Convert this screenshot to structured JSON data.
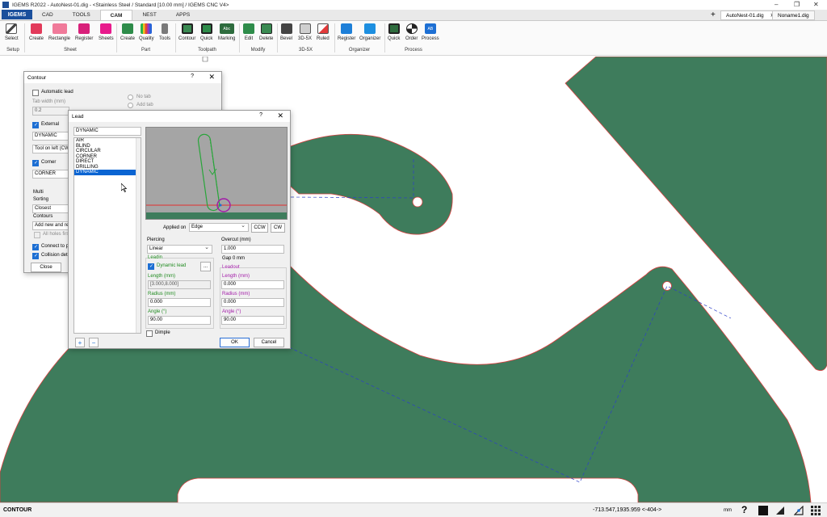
{
  "app": {
    "title": "IGEMS R2022 - AutoNest-01.dig - <Stainless Steel / Standard [10.00 mm] / IGEMS CNC V4>",
    "logo": "IGEMS",
    "tabs": [
      "CAD",
      "TOOLS",
      "CAM",
      "NEST",
      "APPS"
    ],
    "active_tab": "CAM",
    "doc_tabs": [
      "AutoNest-01.dig",
      "Noname1.dig"
    ]
  },
  "ribbon": {
    "buttons": {
      "select": "Select",
      "s_create": "Create",
      "rectangle": "Rectangle",
      "s_register": "Register",
      "sheets": "Sheets",
      "p_create": "Create",
      "quality": "Quality",
      "tools": "Tools",
      "contour": "Contour",
      "quick": "Quick",
      "marking": "Marking",
      "edit": "Edit",
      "delete": "Delete",
      "bevel": "Bevel",
      "threed5x": "3D-5X",
      "ruled": "Ruled",
      "o_register": "Register",
      "organizer": "Organizer",
      "pr_quick": "Quick",
      "order": "Order",
      "process": "Process"
    },
    "groups": {
      "setup": "Setup",
      "sheet": "Sheet",
      "part": "Part",
      "toolpath": "Toolpath",
      "modify": "Modify",
      "threed5x": "3D-5X",
      "organizer": "Organizer",
      "process": "Process"
    },
    "marking_icon_text": "Abc",
    "process_icon_text": "AB"
  },
  "contour_dialog": {
    "title": "Contour",
    "help": "?",
    "close_x": "✕",
    "automatic_lead": "Automatic lead",
    "tab_width_label": "Tab width (mm)",
    "tab_width_value": "0.2",
    "no_tab": "No tab",
    "add_tab": "Add tab",
    "external": "External",
    "external_value": "DYNAMIC",
    "tool_side": "Tool on left (CW)",
    "corner": "Corner",
    "corner_value": "CORNER",
    "multi": "Multi",
    "sorting": "Sorting",
    "sorting_value": "Closest",
    "contours": "Contours",
    "contours_value": "Add new and re",
    "all_holes": "All holes first",
    "connect": "Connect to pa",
    "collision": "Collision detec",
    "close_button": "Close"
  },
  "lead_dialog": {
    "title": "Lead",
    "help": "?",
    "close_x": "✕",
    "name_value": "DYNAMIC",
    "lead_types": [
      "AIR",
      "BLIND",
      "CIRCULAR",
      "CORNER",
      "DIRECT",
      "DRILLING",
      "DYNAMIC"
    ],
    "selected_type": "DYNAMIC",
    "applied_on_label": "Applied on",
    "applied_on_value": "Edge",
    "ccw": "CCW",
    "cw": "CW",
    "piercing_label": "Piercing",
    "piercing_value": "Linear",
    "overcut_label": "Overcut (mm)",
    "overcut_value": "1.000",
    "leadin_title": "Leadin",
    "dynamic_lead": "Dynamic lead",
    "dots_button": "...",
    "gap_label": "Gap 0 mm",
    "leadout_title": "Leadout",
    "leadin": {
      "length_label": "Length (mm)",
      "length_value": "[3.000,8.000]",
      "radius_label": "Radius (mm)",
      "radius_value": "0.000",
      "angle_label": "Angle (°)",
      "angle_value": "90.00"
    },
    "leadout": {
      "length_label": "Length (mm)",
      "length_value": "0.000",
      "radius_label": "Radius (mm)",
      "radius_value": "0.000",
      "angle_label": "Angle (°)",
      "angle_value": "90.00"
    },
    "dimple": "Dimple",
    "ok": "OK",
    "cancel": "Cancel",
    "add_button": "+",
    "remove_button": "−"
  },
  "status": {
    "mode": "CONTOUR",
    "coords": "-713.547,1935.959 <-404->",
    "unit": "mm"
  },
  "colors": {
    "part_fill": "#3e7c5c",
    "part_outline": "#d84040",
    "toolpath": "#2c3fc8",
    "selection": "#0a64d2"
  }
}
